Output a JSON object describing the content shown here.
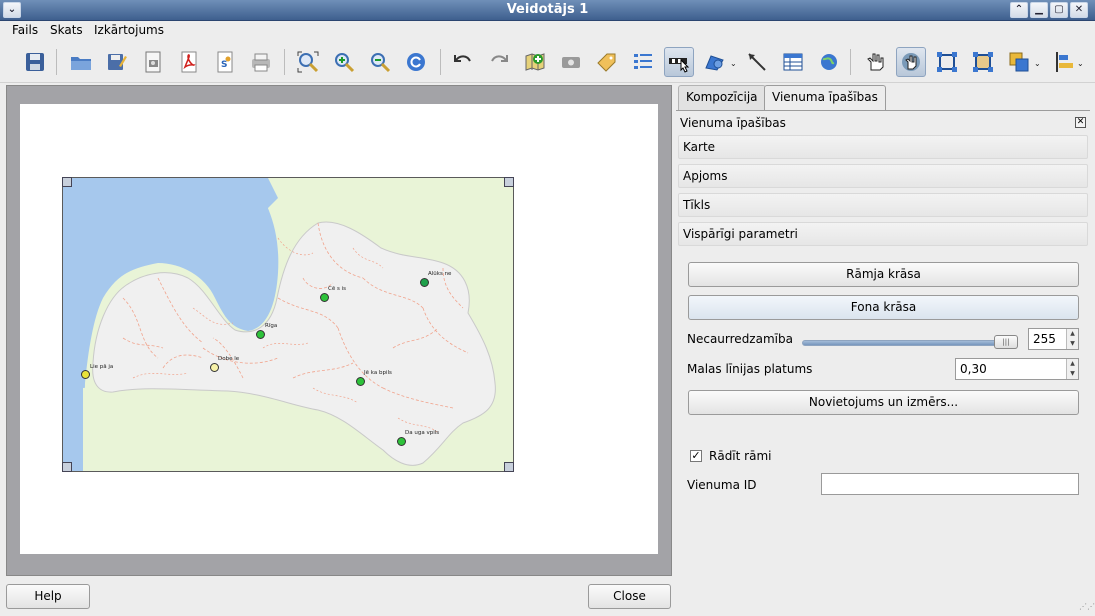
{
  "window": {
    "title": "Veidotājs 1"
  },
  "menu": {
    "items": [
      "Fails",
      "Skats",
      "Izkārtojums"
    ]
  },
  "map": {
    "cities": [
      {
        "name": "Liepāja",
        "label": "Lie pā ja",
        "color": "#e8e33a"
      },
      {
        "name": "Dobele",
        "label": "Dobe le",
        "color": "#f7f2a8"
      },
      {
        "name": "Rīga",
        "label": "Rīga",
        "color": "#2dc23a"
      },
      {
        "name": "Cēsis",
        "label": "Cē s is",
        "color": "#2dc23a"
      },
      {
        "name": "Alūksne",
        "label": "Alūks ne",
        "color": "#1ea04a"
      },
      {
        "name": "Jēkabpils",
        "label": "Jē ka bpils",
        "color": "#2dc23a"
      },
      {
        "name": "Daugavpils",
        "label": "Da uga vpils",
        "color": "#2dc23a"
      }
    ]
  },
  "panel": {
    "tabs": [
      "Kompozīcija",
      "Vienuma īpašības"
    ],
    "title": "Vienuma īpašības",
    "sections": [
      "Karte",
      "Apjoms",
      "Tīkls",
      "Vispārīgi parametri"
    ],
    "frame_color_button": "Rāmja krāsa",
    "background_color_button": "Fona krāsa",
    "opacity_label": "Necaurredzamība",
    "opacity_value": "255",
    "outline_width_label": "Malas līnijas platums",
    "outline_width_value": "0,30",
    "position_size_button": "Novietojums un izmērs...",
    "show_frame_label": "Rādīt rāmi",
    "show_frame_checked": "✓",
    "item_id_label": "Vienuma ID",
    "item_id_value": ""
  },
  "buttons": {
    "help": "Help",
    "close": "Close"
  }
}
